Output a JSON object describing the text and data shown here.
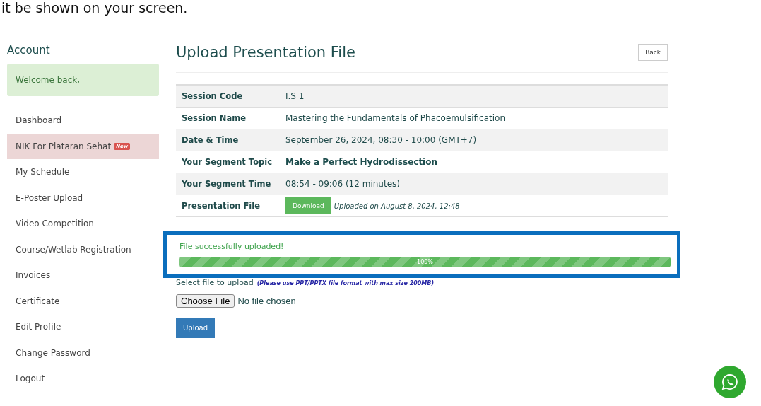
{
  "top_text": "it be shown on your screen.",
  "sidebar": {
    "title": "Account",
    "welcome": "Welcome back,",
    "items": [
      {
        "label": "Dashboard",
        "selected": false
      },
      {
        "label": "NIK For Plataran Sehat",
        "selected": true,
        "badge": "New"
      },
      {
        "label": "My Schedule",
        "selected": false
      },
      {
        "label": "E-Poster Upload",
        "selected": false
      },
      {
        "label": "Video Competition",
        "selected": false
      },
      {
        "label": "Course/Wetlab Registration",
        "selected": false
      },
      {
        "label": "Invoices",
        "selected": false
      },
      {
        "label": "Certificate",
        "selected": false
      },
      {
        "label": "Edit Profile",
        "selected": false
      },
      {
        "label": "Change Password",
        "selected": false
      },
      {
        "label": "Logout",
        "selected": false
      }
    ]
  },
  "page": {
    "title": "Upload Presentation File",
    "back_button": "Back"
  },
  "details": [
    {
      "kind": "text",
      "label": "Session Code",
      "value": "I.S 1"
    },
    {
      "kind": "text",
      "label": "Session Name",
      "value": "Mastering the Fundamentals of Phacoemulsification"
    },
    {
      "kind": "text",
      "label": "Date & Time",
      "value": "September 26, 2024, 08:30 - 10:00 (GMT+7)"
    },
    {
      "kind": "link",
      "label": "Your Segment Topic",
      "value": "Make a Perfect Hydrodissection"
    },
    {
      "kind": "text",
      "label": "Your Segment Time",
      "value": "08:54 - 09:06 (12 minutes)"
    },
    {
      "kind": "file",
      "label": "Presentation File",
      "button": "Download",
      "value": "Uploaded on August 8, 2024, 12:48"
    }
  ],
  "upload_status": {
    "highlighted": true,
    "message": "File successfully uploaded!",
    "level": 1,
    "reading": "100%"
  },
  "upload_form": {
    "label": "Select file to upload",
    "hint": "(Please use PPT/PPTX file format with max size 200MB)",
    "choose_button": "Choose File",
    "file_status": "No file chosen",
    "submit_button": "Upload"
  }
}
